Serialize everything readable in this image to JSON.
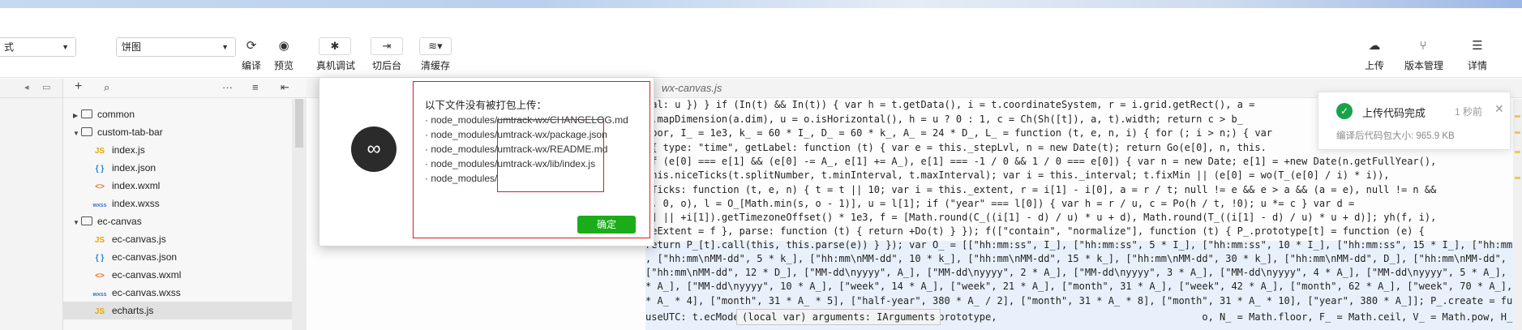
{
  "toolbar": {
    "mode_select": "式",
    "compile_select": "饼图",
    "buttons": {
      "compile": "编译",
      "preview": "预览",
      "remote_debug": "真机调试",
      "background": "切后台",
      "clear_cache": "清缓存",
      "upload": "上传",
      "version": "版本管理",
      "details": "详情"
    }
  },
  "explorer": {
    "items": [
      {
        "name": "common",
        "type": "folder",
        "expanded": false
      },
      {
        "name": "custom-tab-bar",
        "type": "folder",
        "expanded": true
      },
      {
        "name": "index.js",
        "type": "js",
        "badge": "JS"
      },
      {
        "name": "index.json",
        "type": "json",
        "badge": "{ }"
      },
      {
        "name": "index.wxml",
        "type": "wxml",
        "badge": "<>"
      },
      {
        "name": "index.wxss",
        "type": "wxss",
        "badge": "wxss"
      },
      {
        "name": "ec-canvas",
        "type": "folder",
        "expanded": true
      },
      {
        "name": "ec-canvas.js",
        "type": "js",
        "badge": "JS"
      },
      {
        "name": "ec-canvas.json",
        "type": "json",
        "badge": "{ }"
      },
      {
        "name": "ec-canvas.wxml",
        "type": "wxml",
        "badge": "<>"
      },
      {
        "name": "ec-canvas.wxss",
        "type": "wxss",
        "badge": "wxss"
      },
      {
        "name": "echarts.js",
        "type": "js",
        "badge": "JS",
        "selected": true
      }
    ]
  },
  "editor": {
    "tab_name": "wx-canvas.js",
    "hover_tip": "(local var) arguments: IArguments",
    "code_lines": [
      "tal: u }) } if (In(t) && In(t)) { var h = t.getData(), i = t.coordinateSystem, r = i.grid.getRect(), a =",
      "n.mapDimension(a.dim), u = o.isHorizontal(), h = u ? 0 : 1, c = Ch(Sh([t]), a, t).width; return c > b_",
      "loor, I_ = 1e3, k_ = 60 * I_, D_ = 60 * k_, A_ = 24 * D_, L_ = function (t, e, n, i) { for (; i > n;) { var",
      "({ type: \"time\", getLabel: function (t) { var e = this._stepLvl, n = new Date(t); return Go(e[0], n, this.",
      "if (e[0] === e[1] && (e[0] -= A_, e[1] += A_), e[1] === -1 / 0 && 1 / 0 === e[0]) { var n = new Date; e[1] = +new Date(n.getFullYear(),",
      "this.niceTicks(t.splitNumber, t.minInterval, t.maxInterval); var i = this._interval; t.fixMin || (e[0] = wo(T_(e[0] / i) * i)),",
      "eTicks: function (t, e, n) { t = t || 10; var i = this._extent, r = i[1] - i[0], a = r / t; null != e && e > a && (a = e), null != n &&",
      "a, 0, o), l = O_[Math.min(s, o - 1)], u = l[1]; if (\"year\" === l[0]) { var h = r / u, c = Po(h / t, !0); u *= c } var d =",
      "0] || +i[1]).getTimezoneOffset() * 1e3, f = [Math.round(C_((i[1] - d) / u) * u + d), Math.round(T_((i[1] - d) / u) * u + d)]; yh(f, i),",
      "ceExtent = f }, parse: function (t) { return +Do(t) } }); f([\"contain\", \"normalize\"], function (t) { P_.prototype[t] = function (e) {",
      "return P_[t].call(this, this.parse(e)) } }); var O_ = [[\"hh:mm:ss\", I_], [\"hh:mm:ss\", 5 * I_], [\"hh:mm:ss\", 10 * I_], [\"hh:mm:ss\", 15 * I_], [\"hh:mm:ss\", 30 * I_], [\"hh:mm\\nMM-dd\", k_]",
      ", [\"hh:mm\\nMM-dd\", 5 * k_], [\"hh:mm\\nMM-dd\", 10 * k_], [\"hh:mm\\nMM-dd\", 15 * k_], [\"hh:mm\\nMM-dd\", 30 * k_], [\"hh:mm\\nMM-dd\", D_], [\"hh:mm\\nMM-dd\", 2 * D_], [\"hh:mm\\nMM-dd\", 6 * D_],",
      "[\"hh:mm\\nMM-dd\", 12 * D_], [\"MM-dd\\nyyyy\", A_], [\"MM-dd\\nyyyy\", 2 * A_], [\"MM-dd\\nyyyy\", 3 * A_], [\"MM-dd\\nyyyy\", 4 * A_], [\"MM-dd\\nyyyy\", 5 * A_], [\"MM-dd\\nyyyy\", 6 * A_], [\"week\", 7",
      "* A_], [\"MM-dd\\nyyyy\", 10 * A_], [\"week\", 14 * A_], [\"week\", 21 * A_], [\"month\", 31 * A_], [\"week\", 42 * A_], [\"month\", 62 * A_], [\"week\", 70 * A_], [\"quarter\", 95 * A_], [\"month\", 31",
      "* A_ * 4], [\"month\", 31 * A_ * 5], [\"half-year\", 380 * A_ / 2], [\"month\", 31 * A_ * 8], [\"month\", 31 * A_ * 10], [\"year\", 380 * A_]]; P_.create = function (t) { return new P_({",
      "useUTC: t.ecModel.get(\"useUTC\") }) }; var E_ = ch.prototype,                                   o, N_ = Math.floor, F_ = Math.ceil, V_ = Math.pow, H_ = Math.log, W_ = ch.extend({ type:"
    ]
  },
  "modal": {
    "title": "以下文件没有被打包上传：",
    "items": [
      "· node_modules/umtrack-wx/CHANGELOG.md",
      "· node_modules/umtrack-wx/package.json",
      "· node_modules/umtrack-wx/README.md",
      "· node_modules/umtrack-wx/lib/index.js",
      "· node_modules/"
    ],
    "confirm": "确定"
  },
  "toast": {
    "title": "上传代码完成",
    "time": "1 秒前",
    "subtitle": "编译后代码包大小: 965.9 KB"
  },
  "colors": {
    "accent_green": "#1aad19",
    "annotation_red": "#e0191a",
    "toast_success": "#18a34a"
  }
}
